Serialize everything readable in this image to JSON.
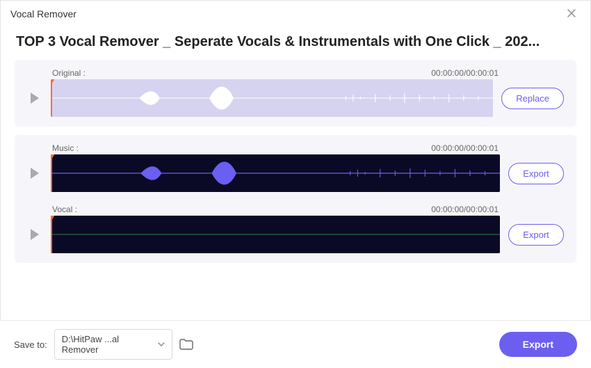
{
  "window": {
    "title": "Vocal Remover"
  },
  "page": {
    "heading": "TOP 3 Vocal Remover _ Seperate Vocals & Instrumentals with One Click _ 202..."
  },
  "tracks": {
    "original": {
      "label": "Original :",
      "time": "00:00:00/00:00:01",
      "action": "Replace"
    },
    "music": {
      "label": "Music :",
      "time": "00:00:00/00:00:01",
      "action": "Export"
    },
    "vocal": {
      "label": "Vocal :",
      "time": "00:00:00/00:00:01",
      "action": "Export"
    }
  },
  "footer": {
    "save_label": "Save to:",
    "path_display": "D:\\HitPaw ...al Remover",
    "export_label": "Export"
  }
}
